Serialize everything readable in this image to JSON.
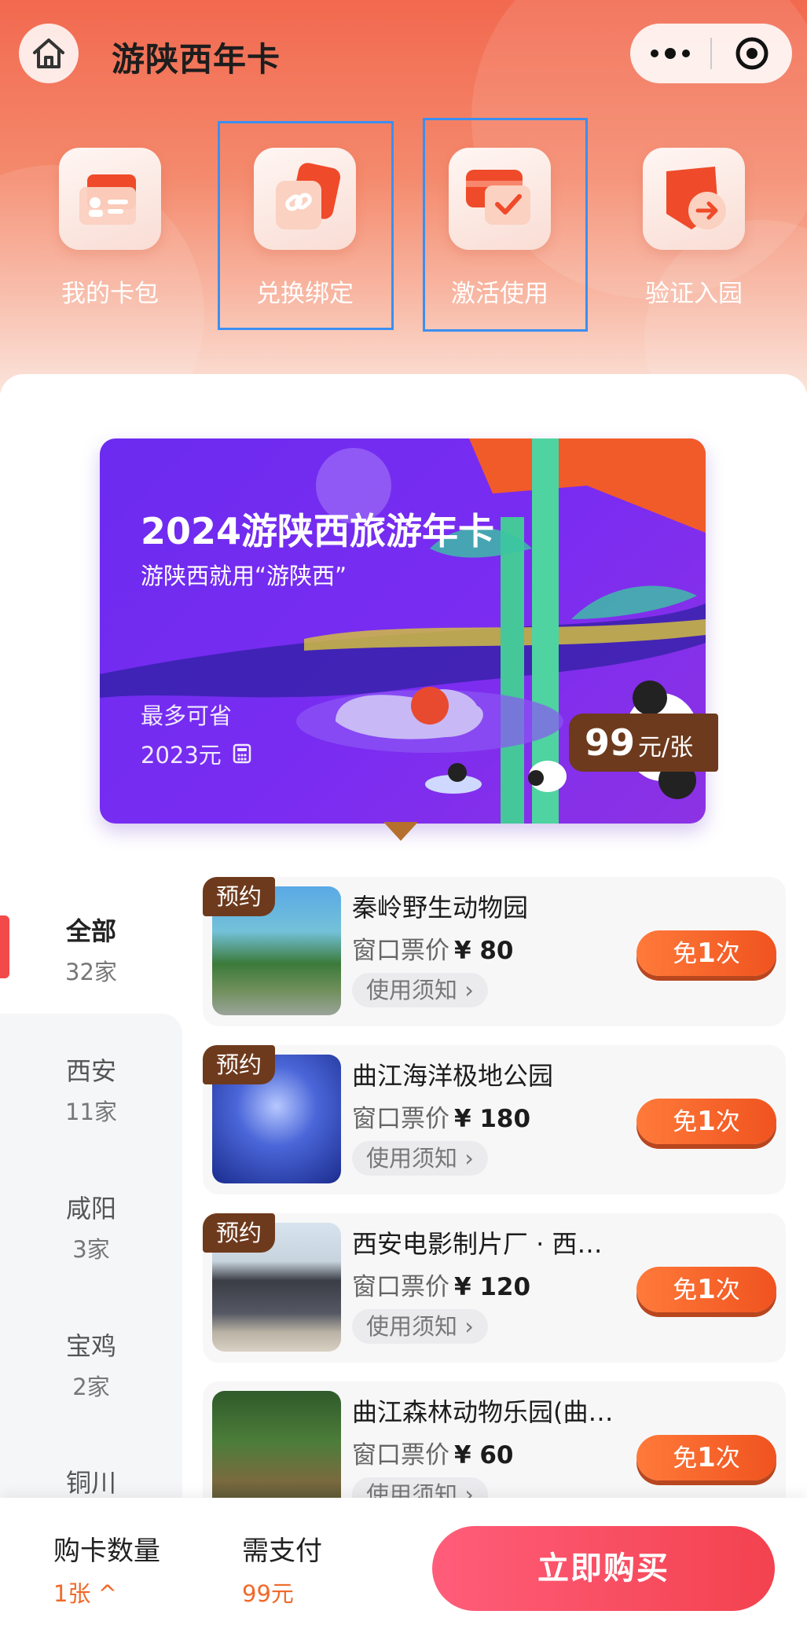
{
  "header": {
    "title": "游陕西年卡"
  },
  "quick_actions": [
    {
      "label": "我的卡包",
      "icon": "id-card-icon"
    },
    {
      "label": "兑换绑定",
      "icon": "link-icon"
    },
    {
      "label": "激活使用",
      "icon": "check-card-icon"
    },
    {
      "label": "验证入园",
      "icon": "enter-arrow-icon"
    }
  ],
  "card": {
    "title": "2024游陕西旅游年卡",
    "subtitle": "游陕西就用“游陕西”",
    "save_label": "最多可省",
    "save_value": "2023元",
    "price_num": "99",
    "price_unit": "元/张"
  },
  "categories": [
    {
      "name": "全部",
      "count": "32家"
    },
    {
      "name": "西安",
      "count": "11家"
    },
    {
      "name": "咸阳",
      "count": "3家"
    },
    {
      "name": "宝鸡",
      "count": "2家"
    },
    {
      "name": "铜川",
      "count": ""
    }
  ],
  "items": [
    {
      "badge": "预约",
      "name": "秦岭野生动物园",
      "price_label": "窗口票价",
      "price": "¥ 80",
      "note": "使用须知 ›",
      "free_pre": "免",
      "free_num": "1",
      "free_post": "次"
    },
    {
      "badge": "预约",
      "name": "曲江海洋极地公园",
      "price_label": "窗口票价",
      "price": "¥ 180",
      "note": "使用须知 ›",
      "free_pre": "免",
      "free_num": "1",
      "free_post": "次"
    },
    {
      "badge": "预约",
      "name": "西安电影制片厂 · 西…",
      "price_label": "窗口票价",
      "price": "¥ 120",
      "note": "使用须知 ›",
      "free_pre": "免",
      "free_num": "1",
      "free_post": "次"
    },
    {
      "badge": "",
      "name": "曲江森林动物乐园(曲…",
      "price_label": "窗口票价",
      "price": "¥ 60",
      "note": "使用须知 ›",
      "free_pre": "免",
      "free_num": "1",
      "free_post": "次"
    }
  ],
  "bottom": {
    "qty_label": "购卡数量",
    "qty_value": "1张 ^",
    "pay_label": "需支付",
    "pay_value": "99元",
    "buy_label": "立即购买"
  },
  "colors": {
    "accent": "#f24a4a",
    "card_purple": "#7a2cf1",
    "highlight_box": "#3b8ff0",
    "price_tag": "#6e3a1d"
  }
}
